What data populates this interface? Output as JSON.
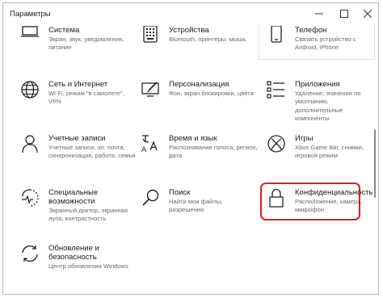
{
  "window": {
    "title": "Параметры"
  },
  "tiles": {
    "system": {
      "title": "Система",
      "desc": "Экран, звук, уведомления, питание",
      "icon": "laptop-icon"
    },
    "devices": {
      "title": "Устройства",
      "desc": "Bluetooth, принтеры, мышь",
      "icon": "keyboard-icon"
    },
    "phone": {
      "title": "Телефон",
      "desc": "Связать устройство с Android, iPhone",
      "icon": "phone-icon"
    },
    "network": {
      "title": "Сеть и Интернет",
      "desc": "Wi-Fi, режим \"в самолете\", VPN",
      "icon": "globe-icon"
    },
    "personalization": {
      "title": "Персонализация",
      "desc": "Фон, экран блокировки, цвета",
      "icon": "paintbrush-icon"
    },
    "apps": {
      "title": "Приложения",
      "desc": "Удаление, значения по умолчанию, дополнительные компоненты",
      "icon": "apps-list-icon"
    },
    "accounts": {
      "title": "Учетные записи",
      "desc": "Учетные записи, эл. почта, синхронизация, работа, семья",
      "icon": "person-icon"
    },
    "time": {
      "title": "Время и язык",
      "desc": "Распознавание голоса, регион, дата",
      "icon": "time-language-icon"
    },
    "gaming": {
      "title": "Игры",
      "desc": "Xbox Game Bar, снимки, игровой режим",
      "icon": "xbox-icon"
    },
    "accessibility": {
      "title": "Специальные возможности",
      "desc": "Экранный диктор, экранная лупа, контрастность",
      "icon": "accessibility-icon"
    },
    "search": {
      "title": "Поиск",
      "desc": "Найти мои файлы, разрешения",
      "icon": "search-icon"
    },
    "privacy": {
      "title": "Конфиденциальность",
      "desc": "Расположение, камера, микрофон",
      "icon": "lock-icon"
    },
    "update": {
      "title": "Обновление и безопасность",
      "desc": "Центр обновления Windows",
      "icon": "sync-icon"
    }
  },
  "colors": {
    "highlight": "#e01b24",
    "text": "#1a1a1a",
    "secondary_text": "#6b6b6b"
  }
}
